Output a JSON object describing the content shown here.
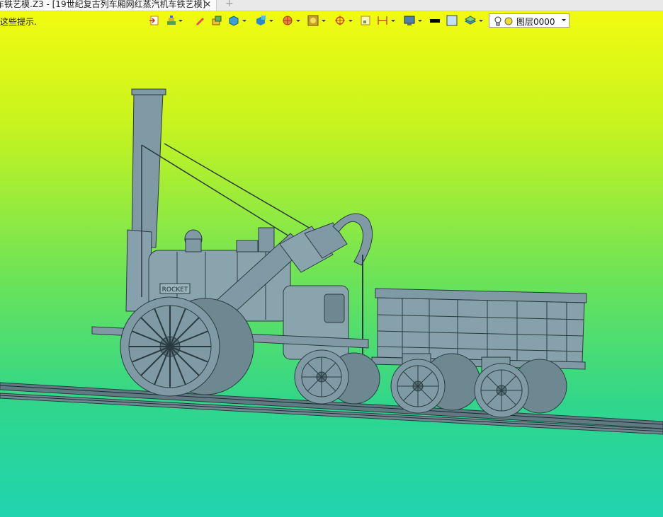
{
  "window": {
    "tab_title": "车铁艺模.Z3 - [19世纪复古列车厢网红蒸汽机车铁艺模]",
    "close_glyph": "✕",
    "new_tab_glyph": "+"
  },
  "hint": "这些提示.",
  "toolbar": {
    "items": [
      "exit-icon",
      "layers-tool-icon",
      "pencil-icon",
      "cube-stack-icon",
      "solid-cube-icon",
      "render-icon",
      "sphere-icon",
      "texture-icon",
      "snap-icon",
      "frame-icon",
      "dimension-icon",
      "display-icon",
      "color-black-swatch",
      "color-blue-swatch",
      "plane-icon"
    ],
    "layer": {
      "name": "图层0000",
      "bulb": "lightbulb-icon",
      "dot": "layer-color-dot"
    }
  },
  "model": {
    "nameplate": "ROCKET"
  },
  "colors": {
    "viewport_top": "#f2fb10",
    "viewport_bottom": "#20d4b0",
    "model_fill": "#7f9aa4",
    "model_edge": "#2b3a40"
  }
}
